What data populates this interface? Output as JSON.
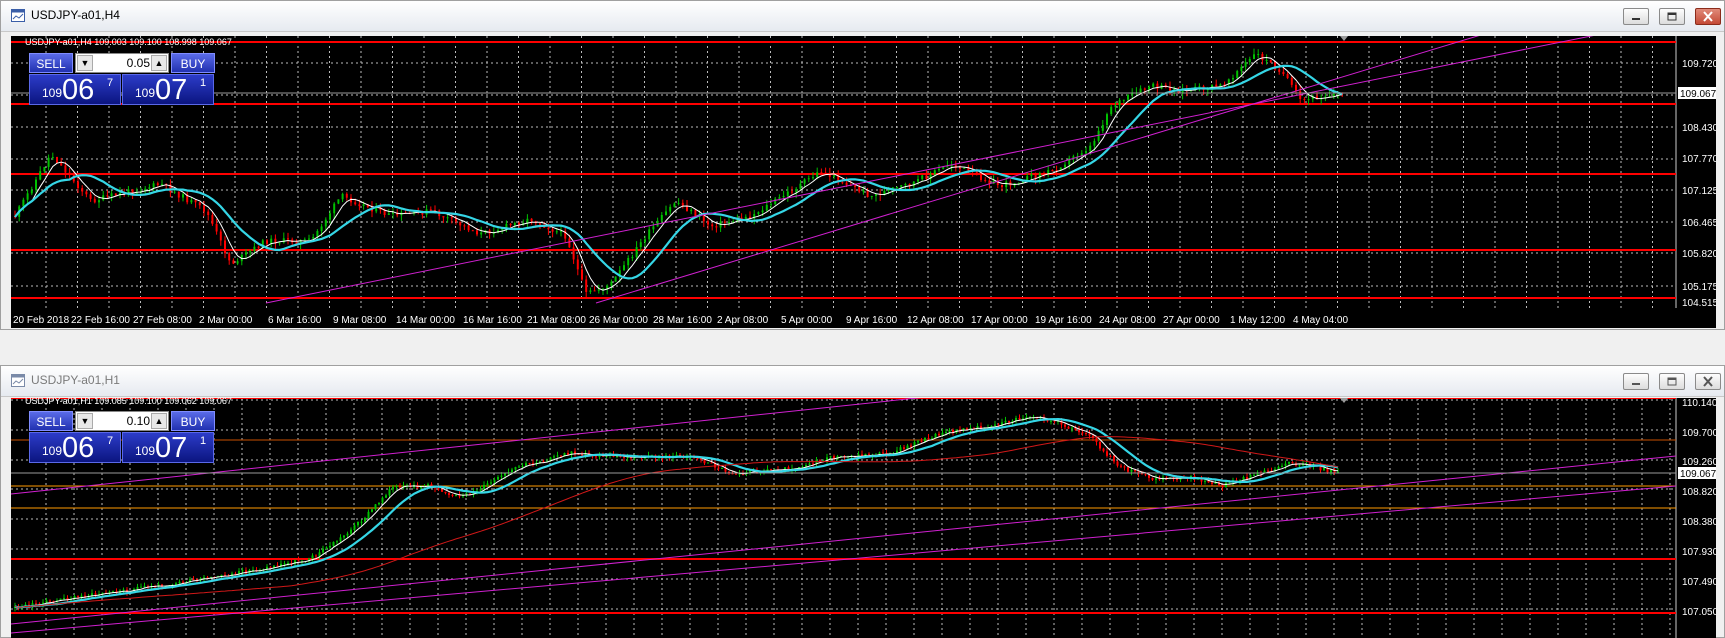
{
  "windows": [
    {
      "title": "USDJPY-a01,H4",
      "chart_header": "USDJPY-a01,H4  109.003 109.100 108.998 109.067",
      "trade_panel": {
        "sell_label": "SELL",
        "buy_label": "BUY",
        "lot": "0.05",
        "sell_small": "109",
        "sell_big": "06",
        "sell_sup": "7",
        "buy_small": "109",
        "buy_big": "07",
        "buy_sup": "1"
      },
      "price_axis": [
        "109.720",
        "109.067",
        "108.430",
        "107.770",
        "107.125",
        "106.465",
        "105.820",
        "105.175",
        "104.515"
      ],
      "current_price": "109.067",
      "time_axis": [
        "20 Feb 2018",
        "22 Feb 16:00",
        "27 Feb 08:00",
        "2 Mar 00:00",
        "6 Mar 16:00",
        "9 Mar 08:00",
        "14 Mar 00:00",
        "16 Mar 16:00",
        "21 Mar 08:00",
        "26 Mar 00:00",
        "28 Mar 16:00",
        "2 Apr 08:00",
        "5 Apr 00:00",
        "9 Apr 16:00",
        "12 Apr 08:00",
        "17 Apr 00:00",
        "19 Apr 16:00",
        "24 Apr 08:00",
        "27 Apr 00:00",
        "1 May 12:00",
        "4 May 04:00"
      ]
    },
    {
      "title": "USDJPY-a01,H1",
      "chart_header": "USDJPY-a01,H1  109.085 109.100 109.062 109.067",
      "trade_panel": {
        "sell_label": "SELL",
        "buy_label": "BUY",
        "lot": "0.10",
        "sell_small": "109",
        "sell_big": "06",
        "sell_sup": "7",
        "buy_small": "109",
        "buy_big": "07",
        "buy_sup": "1"
      },
      "price_axis": [
        "110.140",
        "109.700",
        "109.260",
        "109.067",
        "108.820",
        "108.380",
        "107.930",
        "107.490",
        "107.050"
      ],
      "current_price": "109.067"
    }
  ],
  "colors": {
    "bull": "#00c000",
    "bear": "#ff0000",
    "ma_fast": "#ffffff",
    "ma_slow": "#35d6e6",
    "ma_long": "#d01818",
    "level": "#ff0000",
    "channel": "#d020d0",
    "orange_level": "#ff9a00"
  }
}
